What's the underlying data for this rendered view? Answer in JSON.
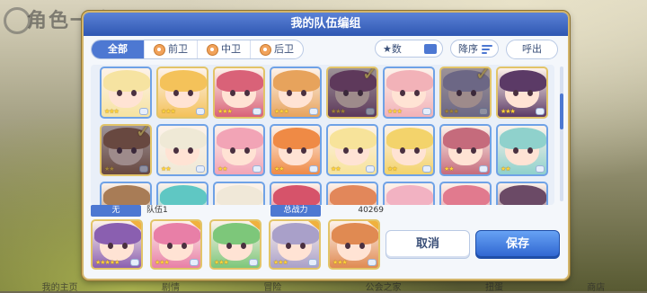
{
  "background": {
    "title": "角色一览",
    "bottom_nav": [
      "我的主页",
      "剧情",
      "冒险",
      "公会之家",
      "扭蛋",
      "商店"
    ]
  },
  "dialog": {
    "title": "我的队伍编组",
    "tabs": [
      {
        "label": "全部",
        "active": true
      },
      {
        "label": "前卫",
        "active": false
      },
      {
        "label": "中卫",
        "active": false
      },
      {
        "label": "后卫",
        "active": false
      }
    ],
    "filter_label": "★数",
    "sort_label": "降序",
    "call_label": "呼出",
    "team_tag": "无",
    "team_name": "队伍1",
    "power_label": "总战力",
    "power_value": "40269",
    "cancel_label": "取消",
    "save_label": "保存"
  },
  "roster": [
    {
      "stars": "★★★",
      "hair": "#f6e3a1",
      "frame": "blue",
      "selected": false,
      "dim": false
    },
    {
      "stars": "★★★",
      "hair": "#f4c25a",
      "frame": "gold",
      "selected": false,
      "dim": false
    },
    {
      "stars": "★★★",
      "hair": "#d96278",
      "frame": "gold",
      "selected": false,
      "dim": false
    },
    {
      "stars": "★★★",
      "hair": "#e7a35c",
      "frame": "blue",
      "selected": false,
      "dim": false
    },
    {
      "stars": "★★★",
      "hair": "#8a4f7d",
      "frame": "gold",
      "selected": true,
      "dim": true
    },
    {
      "stars": "★★★",
      "hair": "#f2b2b8",
      "frame": "blue",
      "selected": false,
      "dim": false
    },
    {
      "stars": "★★★",
      "hair": "#a4a3c8",
      "frame": "gold",
      "selected": true,
      "dim": true
    },
    {
      "stars": "★★★",
      "hair": "#5b3a66",
      "frame": "gold",
      "selected": false,
      "dim": false
    },
    {
      "stars": "★★",
      "hair": "#9d6a4b",
      "frame": "gold",
      "selected": true,
      "dim": true
    },
    {
      "stars": "★★",
      "hair": "#efe9d6",
      "frame": "blue",
      "selected": false,
      "dim": false
    },
    {
      "stars": "★★",
      "hair": "#f2a4b6",
      "frame": "blue",
      "selected": false,
      "dim": false
    },
    {
      "stars": "★★",
      "hair": "#ef8a45",
      "frame": "blue",
      "selected": false,
      "dim": false
    },
    {
      "stars": "★★",
      "hair": "#f7e39a",
      "frame": "blue",
      "selected": false,
      "dim": false
    },
    {
      "stars": "★★",
      "hair": "#f3d36b",
      "frame": "blue",
      "selected": false,
      "dim": false
    },
    {
      "stars": "★★",
      "hair": "#c56b7c",
      "frame": "blue",
      "selected": false,
      "dim": false
    },
    {
      "stars": "★★",
      "hair": "#8fd1cc",
      "frame": "blue",
      "selected": false,
      "dim": false
    },
    {
      "stars": "",
      "hair": "#a87c56",
      "frame": "blue",
      "selected": false,
      "dim": false
    },
    {
      "stars": "",
      "hair": "#5fc7c3",
      "frame": "blue",
      "selected": false,
      "dim": false
    },
    {
      "stars": "",
      "hair": "#f0e8d8",
      "frame": "blue",
      "selected": false,
      "dim": false
    },
    {
      "stars": "",
      "hair": "#d6536a",
      "frame": "blue",
      "selected": false,
      "dim": false
    },
    {
      "stars": "",
      "hair": "#e2875a",
      "frame": "blue",
      "selected": false,
      "dim": false
    },
    {
      "stars": "",
      "hair": "#f2b2c2",
      "frame": "blue",
      "selected": false,
      "dim": false
    },
    {
      "stars": "",
      "hair": "#e17a8e",
      "frame": "blue",
      "selected": false,
      "dim": false
    },
    {
      "stars": "",
      "hair": "#6b4a66",
      "frame": "blue",
      "selected": false,
      "dim": false
    }
  ],
  "team": [
    {
      "stars": "★★★★★",
      "hair": "#8a5fb0"
    },
    {
      "stars": "★★★",
      "hair": "#e87fa7"
    },
    {
      "stars": "★★★",
      "hair": "#7dc77a"
    },
    {
      "stars": "★★★",
      "hair": "#a9a0c9"
    },
    {
      "stars": "★★★",
      "hair": "#e08a52"
    }
  ]
}
